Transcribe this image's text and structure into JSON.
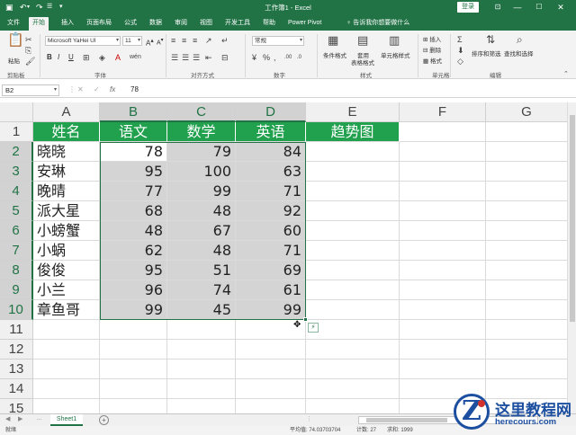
{
  "titlebar": {
    "title": "工作簿1 - Excel",
    "login": "登录",
    "save_icon": "save-icon",
    "undo_icon": "undo-icon",
    "redo_icon": "redo-icon",
    "customize_icon": "customize-qat-icon",
    "ribbon_options_icon": "ribbon-display-icon",
    "minimize": "—",
    "maximize": "☐",
    "close": "✕"
  },
  "tabs": [
    "文件",
    "开始",
    "插入",
    "页面布局",
    "公式",
    "数据",
    "审阅",
    "视图",
    "开发工具",
    "帮助",
    "Power Pivot"
  ],
  "active_tab": "开始",
  "tell_me": "告诉我你想要做什么",
  "ribbon": {
    "clipboard": {
      "label": "剪贴板",
      "paste": "粘贴"
    },
    "font": {
      "label": "字体",
      "font_name": "Microsoft YaHei UI",
      "font_size": "11",
      "bold": "B",
      "italic": "I",
      "underline": "U"
    },
    "alignment": {
      "label": "对齐方式"
    },
    "number": {
      "label": "数字",
      "format": "常规"
    },
    "styles": {
      "label": "样式",
      "conditional": "条件格式",
      "table1": "套用",
      "table2": "表格格式",
      "cell_styles": "单元格样式"
    },
    "cells": {
      "label": "单元格",
      "insert": "插入",
      "delete": "删除",
      "format": "格式"
    },
    "editing": {
      "label": "编辑",
      "sort": "排序和筛选",
      "find": "查找和选择"
    }
  },
  "formula_bar": {
    "name_box": "B2",
    "cancel": "✕",
    "enter": "✓",
    "fx": "fx",
    "value": "78"
  },
  "sheet": {
    "columns": [
      "A",
      "B",
      "C",
      "D",
      "E",
      "F",
      "G"
    ],
    "rows": [
      "1",
      "2",
      "3",
      "4",
      "5",
      "6",
      "7",
      "8",
      "9",
      "10",
      "11",
      "12",
      "13",
      "14",
      "15"
    ],
    "header": [
      "姓名",
      "语文",
      "数学",
      "英语",
      "趋势图"
    ],
    "data": [
      [
        "晓晓",
        "78",
        "79",
        "84"
      ],
      [
        "安琳",
        "95",
        "100",
        "63"
      ],
      [
        "晚晴",
        "77",
        "99",
        "71"
      ],
      [
        "派大星",
        "68",
        "48",
        "92"
      ],
      [
        "小螃蟹",
        "48",
        "67",
        "60"
      ],
      [
        "小蜗",
        "62",
        "48",
        "71"
      ],
      [
        "俊俊",
        "95",
        "51",
        "69"
      ],
      [
        "小兰",
        "96",
        "74",
        "61"
      ],
      [
        "章鱼哥",
        "99",
        "45",
        "99"
      ]
    ],
    "selection": "B2:D10",
    "active_cell": "B2"
  },
  "sheet_tabs": {
    "sheets": [
      "Sheet1"
    ],
    "add_icon": "add-sheet-icon"
  },
  "status": {
    "mode": "就绪",
    "average": "平均值: 74.03703704",
    "count": "计数: 27",
    "sum": "求和: 1999"
  },
  "watermark": {
    "logo_letter": "Z",
    "name": "这里教程网",
    "url": "herecours.com"
  }
}
